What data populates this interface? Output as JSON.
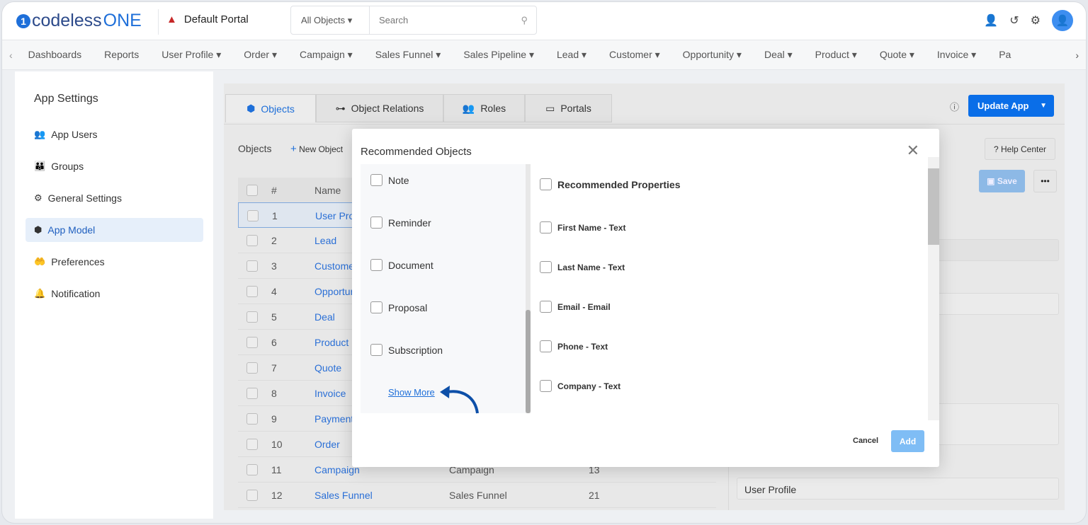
{
  "header": {
    "brand_prefix": "codeless",
    "brand_suffix": "ONE",
    "portal": "Default Portal",
    "search_scope": "All Objects",
    "search_placeholder": "Search"
  },
  "nav": {
    "items": [
      "Dashboards",
      "Reports",
      "User Profile ▾",
      "Order ▾",
      "Campaign ▾",
      "Sales Funnel ▾",
      "Sales Pipeline ▾",
      "Lead ▾",
      "Customer ▾",
      "Opportunity ▾",
      "Deal ▾",
      "Product ▾",
      "Quote ▾",
      "Invoice ▾",
      "Pa"
    ]
  },
  "sidebar": {
    "title": "App Settings",
    "items": [
      {
        "label": "App Users",
        "icon": "users-icon"
      },
      {
        "label": "Groups",
        "icon": "groups-icon"
      },
      {
        "label": "General Settings",
        "icon": "gear-icon"
      },
      {
        "label": "App Model",
        "icon": "cube-icon",
        "active": true
      },
      {
        "label": "Preferences",
        "icon": "hand-heart-icon"
      },
      {
        "label": "Notification",
        "icon": "bell-icon"
      }
    ]
  },
  "tabs": [
    {
      "label": "Objects",
      "active": true
    },
    {
      "label": "Object Relations"
    },
    {
      "label": "Roles"
    },
    {
      "label": "Portals"
    }
  ],
  "toolbar": {
    "objects_label": "Objects",
    "new_object": "New Object",
    "update_app": "Update App",
    "help_center": "? Help Center",
    "save": "Save",
    "more": "•••"
  },
  "table": {
    "headers": [
      "#",
      "Name"
    ],
    "rows": [
      {
        "n": "1",
        "name": "User Profile"
      },
      {
        "n": "2",
        "name": "Lead"
      },
      {
        "n": "3",
        "name": "Customer"
      },
      {
        "n": "4",
        "name": "Opportunity"
      },
      {
        "n": "5",
        "name": "Deal"
      },
      {
        "n": "6",
        "name": "Product"
      },
      {
        "n": "7",
        "name": "Quote"
      },
      {
        "n": "8",
        "name": "Invoice"
      },
      {
        "n": "9",
        "name": "Payment"
      },
      {
        "n": "10",
        "name": "Order"
      },
      {
        "n": "11",
        "name": "Campaign",
        "label": "Campaign",
        "count": "13"
      },
      {
        "n": "12",
        "name": "Sales Funnel",
        "label": "Sales Funnel",
        "count": "21"
      }
    ]
  },
  "detail": {
    "name_value": "User Profile"
  },
  "modal": {
    "title": "Recommended Objects",
    "objects": [
      "Note",
      "Reminder",
      "Document",
      "Proposal",
      "Subscription"
    ],
    "show_more": "Show More",
    "properties_header": "Recommended Properties",
    "properties": [
      "First Name - Text",
      "Last Name - Text",
      "Email - Email",
      "Phone - Text",
      "Company - Text"
    ],
    "cancel": "Cancel",
    "add": "Add"
  },
  "colors": {
    "accent": "#0a6ee8",
    "link": "#2a6fd6",
    "annotation_arrow": "#0d4fa8"
  }
}
